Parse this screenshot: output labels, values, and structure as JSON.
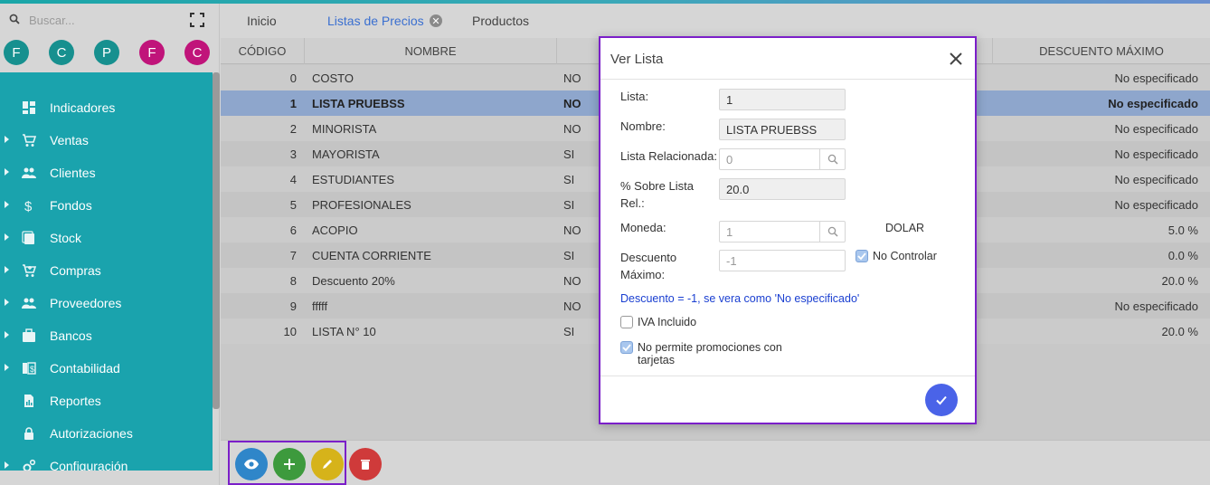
{
  "colors": {
    "sidebar": "#1aa3ad",
    "accent": "#3a6fd0",
    "highlight": "#7b1fc9",
    "selected_row": "#8ea6cc"
  },
  "search": {
    "placeholder": "Buscar..."
  },
  "avatars": [
    {
      "letter": "F",
      "color": "#17908f"
    },
    {
      "letter": "C",
      "color": "#17908f"
    },
    {
      "letter": "P",
      "color": "#17908f"
    },
    {
      "letter": "F",
      "color": "#c0147a"
    },
    {
      "letter": "C",
      "color": "#c0147a"
    }
  ],
  "menu": [
    {
      "label": "Indicadores",
      "icon": "dashboard-icon",
      "expandable": false
    },
    {
      "label": "Ventas",
      "icon": "cart-icon",
      "expandable": true
    },
    {
      "label": "Clientes",
      "icon": "people-icon",
      "expandable": true
    },
    {
      "label": "Fondos",
      "icon": "dollar-icon",
      "expandable": true
    },
    {
      "label": "Stock",
      "icon": "stock-icon",
      "expandable": true
    },
    {
      "label": "Compras",
      "icon": "cart-plus-icon",
      "expandable": true
    },
    {
      "label": "Proveedores",
      "icon": "people-icon",
      "expandable": true
    },
    {
      "label": "Bancos",
      "icon": "briefcase-icon",
      "expandable": true
    },
    {
      "label": "Contabilidad",
      "icon": "ledger-icon",
      "expandable": true
    },
    {
      "label": "Reportes",
      "icon": "report-icon",
      "expandable": false
    },
    {
      "label": "Autorizaciones",
      "icon": "lock-icon",
      "expandable": false
    },
    {
      "label": "Configuración",
      "icon": "gears-icon",
      "expandable": true
    }
  ],
  "tabs": [
    {
      "label": "Inicio"
    },
    {
      "label": "Listas de Precios"
    },
    {
      "label": "Productos"
    }
  ],
  "table": {
    "headers": {
      "code": "CÓDIGO",
      "name": "NOMBRE",
      "discount": "DESCUENTO MÁXIMO"
    },
    "rows": [
      {
        "code": "0",
        "name": "COSTO",
        "flag": "NO",
        "discount": "No especificado"
      },
      {
        "code": "1",
        "name": "LISTA PRUEBSS",
        "flag": "NO",
        "discount": "No especificado"
      },
      {
        "code": "2",
        "name": "MINORISTA",
        "flag": "NO",
        "discount": "No especificado"
      },
      {
        "code": "3",
        "name": "MAYORISTA",
        "flag": "SI",
        "discount": "No especificado"
      },
      {
        "code": "4",
        "name": "ESTUDIANTES",
        "flag": "SI",
        "discount": "No especificado"
      },
      {
        "code": "5",
        "name": "PROFESIONALES",
        "flag": "SI",
        "discount": "No especificado"
      },
      {
        "code": "6",
        "name": "ACOPIO",
        "flag": "NO",
        "discount": "5.0 %"
      },
      {
        "code": "7",
        "name": "CUENTA CORRIENTE",
        "flag": "SI",
        "discount": "0.0 %"
      },
      {
        "code": "8",
        "name": "Descuento 20%",
        "flag": "NO",
        "discount": "20.0 %"
      },
      {
        "code": "9",
        "name": "fffff",
        "flag": "NO",
        "discount": "No especificado"
      },
      {
        "code": "10",
        "name": "LISTA N° 10",
        "flag": "SI",
        "discount": "20.0 %"
      }
    ]
  },
  "actions": [
    {
      "icon": "eye-icon",
      "color": "#2f86c9"
    },
    {
      "icon": "plus-icon",
      "color": "#3d9a3d"
    },
    {
      "icon": "pencil-icon",
      "color": "#d6b31a"
    },
    {
      "icon": "trash-icon",
      "color": "#cf3a3a"
    }
  ],
  "dialog": {
    "title": "Ver Lista",
    "lista_label": "Lista:",
    "lista_value": "1",
    "nombre_label": "Nombre:",
    "nombre_value": "LISTA PRUEBSS",
    "relacionada_label": "Lista Relacionada:",
    "relacionada_value": "0",
    "sobre_label_1": "% Sobre Lista",
    "sobre_label_2": "Rel.:",
    "sobre_value": "20.0",
    "moneda_label": "Moneda:",
    "moneda_value": "1",
    "moneda_name": "DOLAR",
    "descuento_label_1": "Descuento",
    "descuento_label_2": "Máximo:",
    "descuento_value": "-1",
    "no_controlar_label": "No Controlar",
    "no_controlar_checked": true,
    "note": "Descuento = -1, se vera como 'No especificado'",
    "iva_label": "IVA Incluido",
    "iva_checked": false,
    "promo_label_1": "No permite promociones con",
    "promo_label_2": "tarjetas",
    "promo_checked": true
  }
}
